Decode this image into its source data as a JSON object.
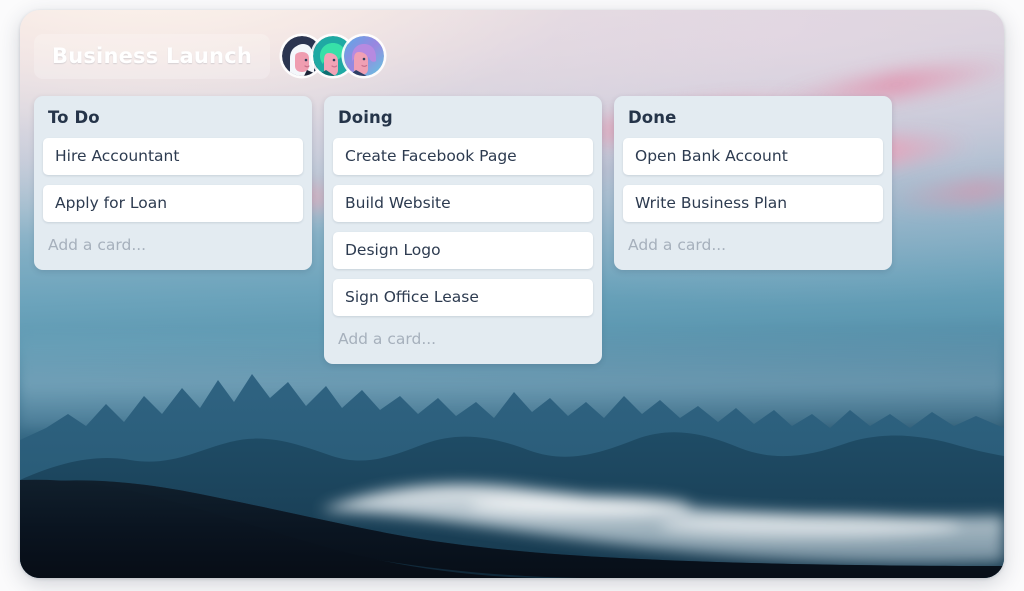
{
  "board": {
    "title": "Business Launch",
    "background_description": "sunset mountain landscape photo",
    "colors": {
      "list_background": "#e3ebf1",
      "card_background": "#ffffff",
      "card_text": "#2d3b50",
      "placeholder_text": "#a6b0bc",
      "title_text": "#ffffff"
    }
  },
  "members": [
    {
      "name": "member-avatar-1",
      "ring": "#ffffff",
      "circle": "#2b3550",
      "hair": "#f4f7fb",
      "skin": "#ef9db0"
    },
    {
      "name": "member-avatar-2",
      "ring": "#ffffff",
      "circle": "#1fa9a3",
      "hair": "#37e0a8",
      "skin": "#f2a3b6"
    },
    {
      "name": "member-avatar-3",
      "ring": "#ffffff",
      "circle": "#5aa9e6",
      "hair": "#b68ae0",
      "skin": "#f0a0b4"
    }
  ],
  "lists": [
    {
      "title": "To Do",
      "cards": [
        "Hire Accountant",
        "Apply for Loan"
      ],
      "add_card_label": "Add a card..."
    },
    {
      "title": "Doing",
      "cards": [
        "Create Facebook Page",
        "Build Website",
        "Design Logo",
        "Sign Office Lease"
      ],
      "add_card_label": "Add a card..."
    },
    {
      "title": "Done",
      "cards": [
        "Open Bank Account",
        "Write Business Plan"
      ],
      "add_card_label": "Add a card..."
    }
  ]
}
